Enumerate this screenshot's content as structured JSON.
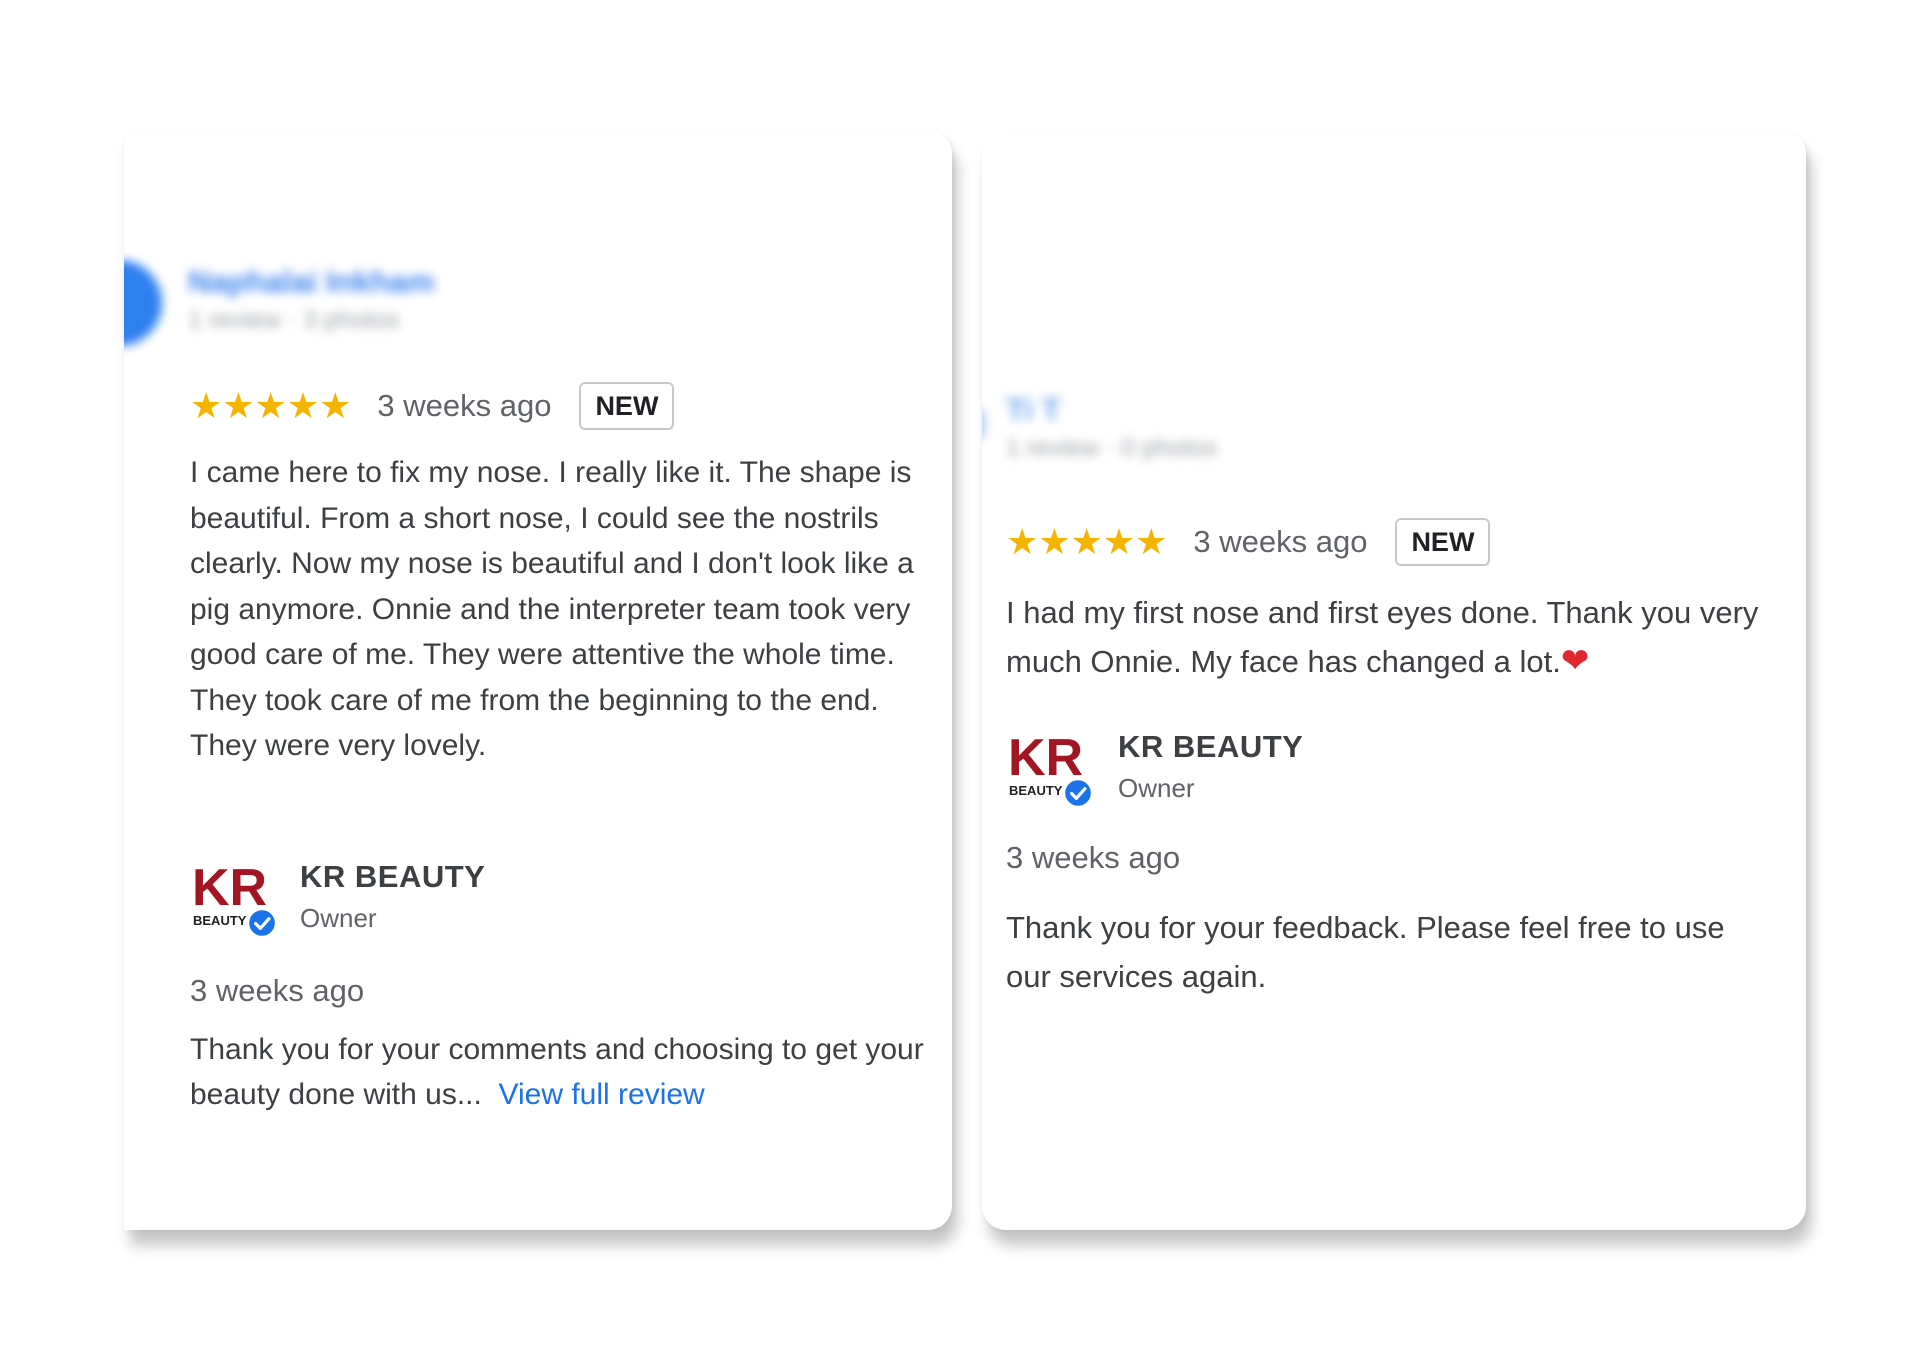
{
  "colors": {
    "star": "#f5b400",
    "link": "#1a73e8",
    "reviewer_name": "#3f86ee",
    "heart": "#e0262f",
    "verified": "#1a73e8",
    "logo_red": "#a31523"
  },
  "reviews": [
    {
      "reviewer_name": "Naphalai Inkham",
      "reviewer_meta": "1 review · 3 photos",
      "rating": 5,
      "stars": "★★★★★",
      "time": "3 weeks ago",
      "badge": "NEW",
      "text": "I came here to fix my nose. I really like it. The shape is beautiful. From a short nose, I could see the nostrils clearly. Now my nose is beautiful and I don't look like a pig anymore. Onnie and the interpreter team took very good care of me. They were attentive the whole time. They took care of me from the beginning to the end. They were very lovely.",
      "owner": {
        "name": "KR BEAUTY",
        "role": "Owner",
        "logo_text_top": "KR",
        "logo_text_bottom": "BEAUTY",
        "time": "3 weeks ago",
        "reply": "Thank you for your comments and choosing to get your beauty done with us...",
        "link": "View full review"
      }
    },
    {
      "reviewer_name": "Ti T",
      "reviewer_meta": "1 review · 0 photos",
      "rating": 5,
      "stars": "★★★★★",
      "time": "3 weeks ago",
      "badge": "NEW",
      "text": "I had my first nose and first eyes done. Thank you very much Onnie. My face has changed a lot.",
      "emoji": "❤",
      "owner": {
        "name": "KR BEAUTY",
        "role": "Owner",
        "logo_text_top": "KR",
        "logo_text_bottom": "BEAUTY",
        "time": "3 weeks ago",
        "reply": "Thank you for your feedback. Please feel free to use our services again."
      }
    }
  ]
}
